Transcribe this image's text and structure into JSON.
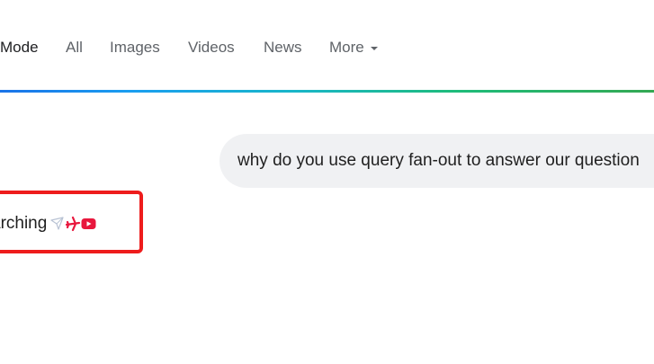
{
  "nav": {
    "tabs": [
      {
        "label": "Mode",
        "active": true
      },
      {
        "label": "All",
        "active": false
      },
      {
        "label": "Images",
        "active": false
      },
      {
        "label": "Videos",
        "active": false
      },
      {
        "label": "News",
        "active": false
      },
      {
        "label": "More",
        "active": false
      }
    ]
  },
  "chat": {
    "user_query": "why do you use query fan-out to answer our question",
    "status_text": "arching",
    "status_icons": [
      "paper-plane-icon",
      "airplane-icon",
      "youtube-icon"
    ]
  },
  "colors": {
    "gradient_start": "#1a73e8",
    "gradient_end": "#34a853",
    "highlight_border": "#ee1c1c",
    "bubble_bg": "#f0f1f3",
    "youtube_red": "#e8173d"
  }
}
